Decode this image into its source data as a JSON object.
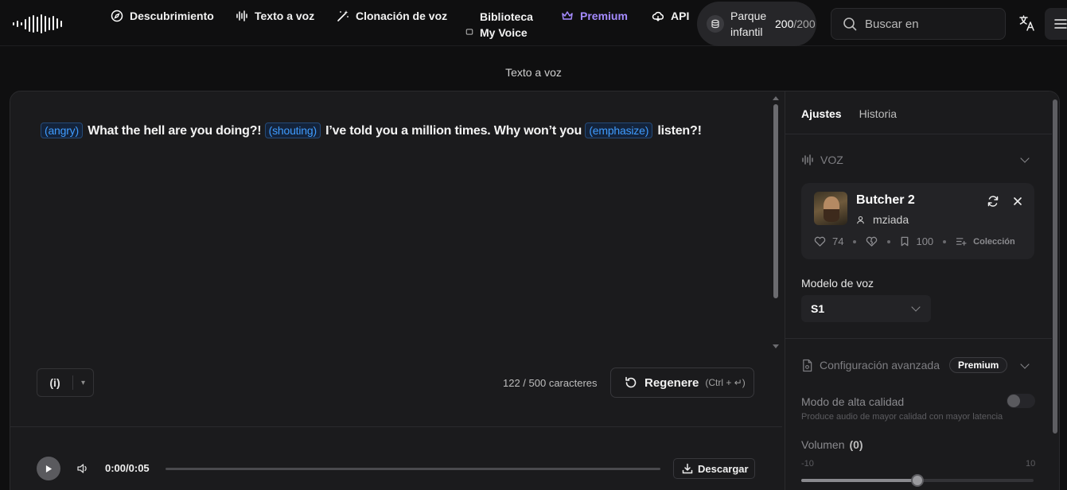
{
  "nav": {
    "items": [
      {
        "label": "Descubrimiento",
        "icon": "compass-icon"
      },
      {
        "label": "Texto a voz",
        "icon": "waveform-icon"
      },
      {
        "label": "Clonación de voz",
        "icon": "magic-wand-icon"
      },
      {
        "label_line1": "Biblioteca",
        "label_line2": "My Voice",
        "icon": "library-icon"
      },
      {
        "label": "Premium",
        "icon": "crown-icon"
      },
      {
        "label": "API",
        "icon": "cloud-icon"
      }
    ],
    "credits": {
      "label_line1": "Parque",
      "label_line2": "infantil",
      "used": "200",
      "total": "/200"
    },
    "search_placeholder": "Buscar en"
  },
  "page_title": "Texto a voz",
  "editor": {
    "segments": [
      {
        "tag": "(angry)",
        "text": "What the hell are you doing?!"
      },
      {
        "tag": "(shouting)",
        "text": "I’ve told you a million times. Why won’t you"
      },
      {
        "tag": "(emphasize)",
        "text": "listen?!"
      }
    ],
    "emotion_button": "(i)",
    "char_count": "122 / 500 caracteres",
    "regenerate_label": "Regenere",
    "regenerate_hint": "(Ctrl + ↵)",
    "colors": {
      "tag_text": "#3f9cff",
      "accent_premium": "#a58bff"
    }
  },
  "player": {
    "time": "0:00/0:05",
    "download_label": "Descargar",
    "progress": 0
  },
  "side": {
    "tabs": [
      {
        "label": "Ajustes",
        "active": true
      },
      {
        "label": "Historia",
        "active": false
      }
    ],
    "voice_section": "VOZ",
    "voice": {
      "name": "Butcher 2",
      "author": "mziada",
      "likes": "74",
      "bookmarks": "100",
      "collection": "Colección"
    },
    "model_label": "Modelo de voz",
    "model_value": "S1",
    "advanced_label": "Configuración avanzada",
    "premium_badge": "Premium",
    "hq_label": "Modo de alta calidad",
    "hq_desc": "Produce audio de mayor calidad con mayor latencia",
    "volume_label": "Volumen",
    "volume_value": "(0)",
    "volume_min": "-10",
    "volume_max": "10",
    "volume_fraction": 0.5
  }
}
